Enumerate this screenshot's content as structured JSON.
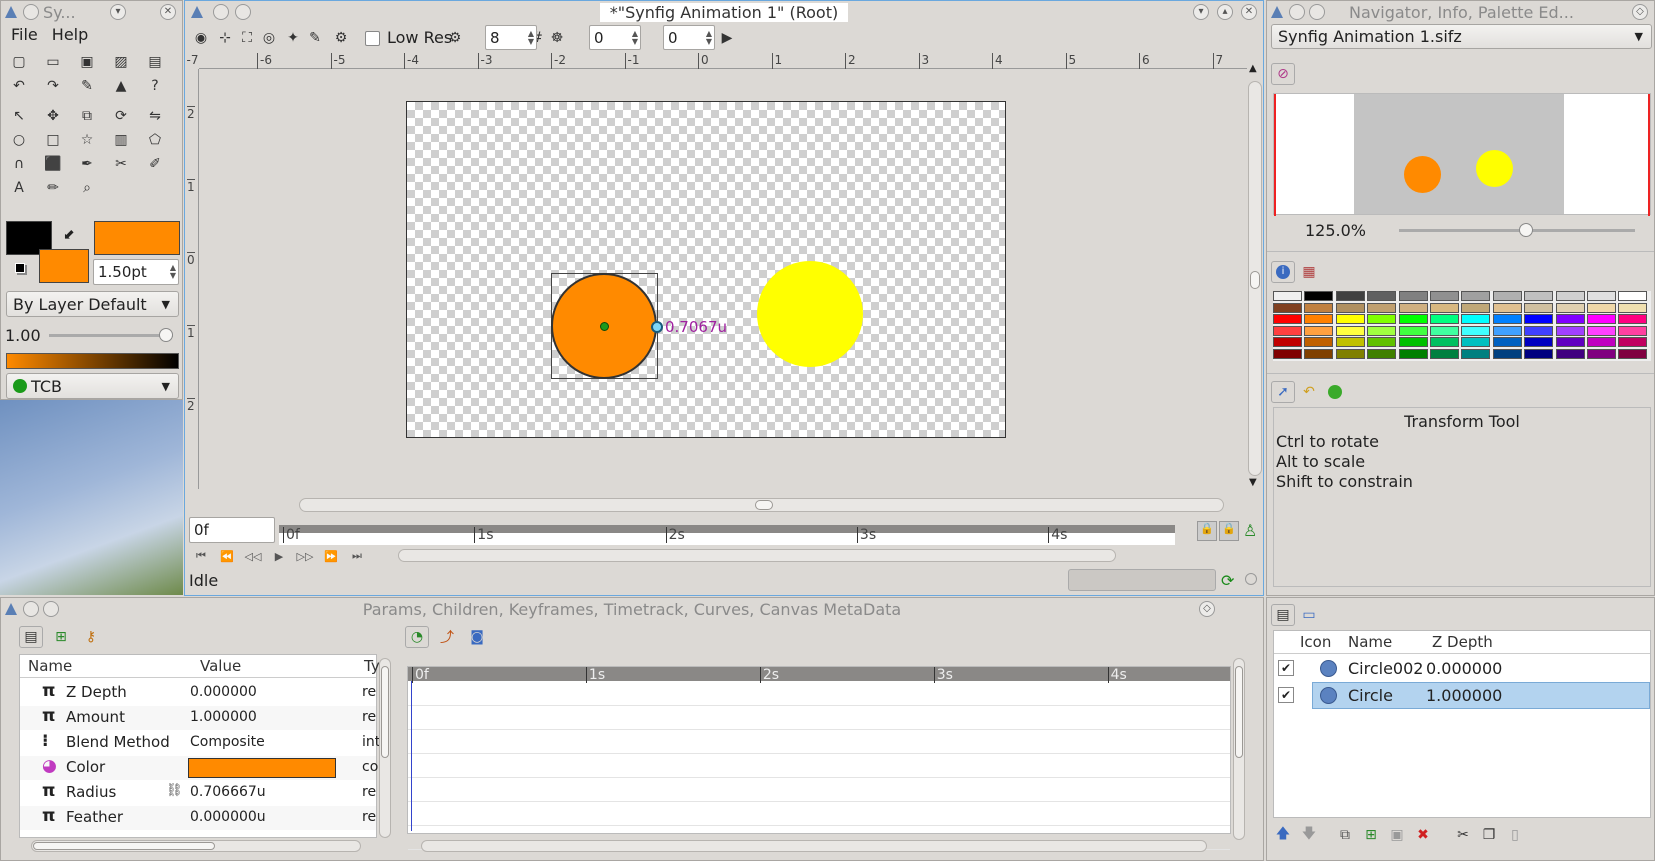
{
  "toolbox": {
    "title": "Sy...",
    "menu": [
      "File",
      "Help"
    ],
    "outline_width": "1.50pt",
    "blend": "By Layer Default",
    "opacity": "1.00",
    "interp": "TCB",
    "colors": {
      "outline": "#000000",
      "fill": "#ff8a00"
    }
  },
  "canvas": {
    "title": "*\"Synfig Animation 1\" (Root)",
    "low_res": "Low Res",
    "res_value": "8",
    "onion_past": "0",
    "onion_future": "0",
    "ruler_h": [
      "-7",
      "-6",
      "-5",
      "-4",
      "-3",
      "-2",
      "-1",
      "0",
      "1",
      "2",
      "3",
      "4",
      "5",
      "6",
      "7"
    ],
    "ruler_v": [
      "2",
      "1",
      "0",
      "1",
      "2"
    ],
    "radius_label": "0.7067u",
    "frame": "0f",
    "time_marks": [
      "0f",
      "1s",
      "2s",
      "3s",
      "4s"
    ],
    "status": "Idle",
    "circle1_color": "#ff8a00",
    "circle2_color": "#ffff00"
  },
  "navigator": {
    "title": "Navigator, Info, Palette Ed...",
    "file": "Synfig Animation 1.sifz",
    "zoom": "125.0%"
  },
  "tooloptions": {
    "title": "Transform Tool",
    "lines": [
      "Ctrl to rotate",
      "Alt to scale",
      "Shift to constrain"
    ]
  },
  "params": {
    "title": "Params, Children, Keyframes, Timetrack, Curves, Canvas MetaData",
    "headers": [
      "Name",
      "Value",
      "Ty"
    ],
    "rows": [
      {
        "name": "Z Depth",
        "value": "0.000000",
        "type": "re"
      },
      {
        "name": "Amount",
        "value": "1.000000",
        "type": "re"
      },
      {
        "name": "Blend Method",
        "value": "Composite",
        "type": "int"
      },
      {
        "name": "Color",
        "value": "",
        "type": "co"
      },
      {
        "name": "Radius",
        "value": "0.706667u",
        "type": "re"
      },
      {
        "name": "Feather",
        "value": "0.000000u",
        "type": "re"
      }
    ],
    "time_marks": [
      "0f",
      "1s",
      "2s",
      "3s",
      "4s"
    ]
  },
  "layers": {
    "headers": [
      "Icon",
      "Name",
      "Z Depth"
    ],
    "rows": [
      {
        "name": "Circle002",
        "z": "0.000000"
      },
      {
        "name": "Circle",
        "z": "1.000000"
      }
    ]
  },
  "palette": [
    [
      "#f0f0f0",
      "#000000",
      "#404040",
      "#606060",
      "#808080",
      "#909090",
      "#a0a0a0",
      "#b0b0b0",
      "#c0c0c0",
      "#d0d0d0",
      "#e0e0e0",
      "#ffffff"
    ],
    [
      "#804020",
      "#c08040",
      "#b09060",
      "#c0a070",
      "#d0b080",
      "#d8b880",
      "#c0a878",
      "#e0c090",
      "#d0c0a0",
      "#e0d0b0",
      "#f0d8a8",
      "#f0e0b0"
    ],
    [
      "#ff0000",
      "#ff8000",
      "#ffff00",
      "#80ff00",
      "#00ff00",
      "#00ff80",
      "#00ffff",
      "#0080ff",
      "#0000ff",
      "#8000ff",
      "#ff00ff",
      "#ff0080"
    ],
    [
      "#ff4040",
      "#ffa040",
      "#ffff40",
      "#a0ff40",
      "#40ff40",
      "#40ffa0",
      "#40ffff",
      "#40a0ff",
      "#4040ff",
      "#a040ff",
      "#ff40ff",
      "#ff40a0"
    ],
    [
      "#c00000",
      "#c06000",
      "#c0c000",
      "#60c000",
      "#00c000",
      "#00c060",
      "#00c0c0",
      "#0060c0",
      "#0000c0",
      "#6000c0",
      "#c000c0",
      "#c00060"
    ],
    [
      "#800000",
      "#804000",
      "#808000",
      "#408000",
      "#008000",
      "#008040",
      "#008080",
      "#004080",
      "#000080",
      "#400080",
      "#800080",
      "#800040"
    ]
  ]
}
